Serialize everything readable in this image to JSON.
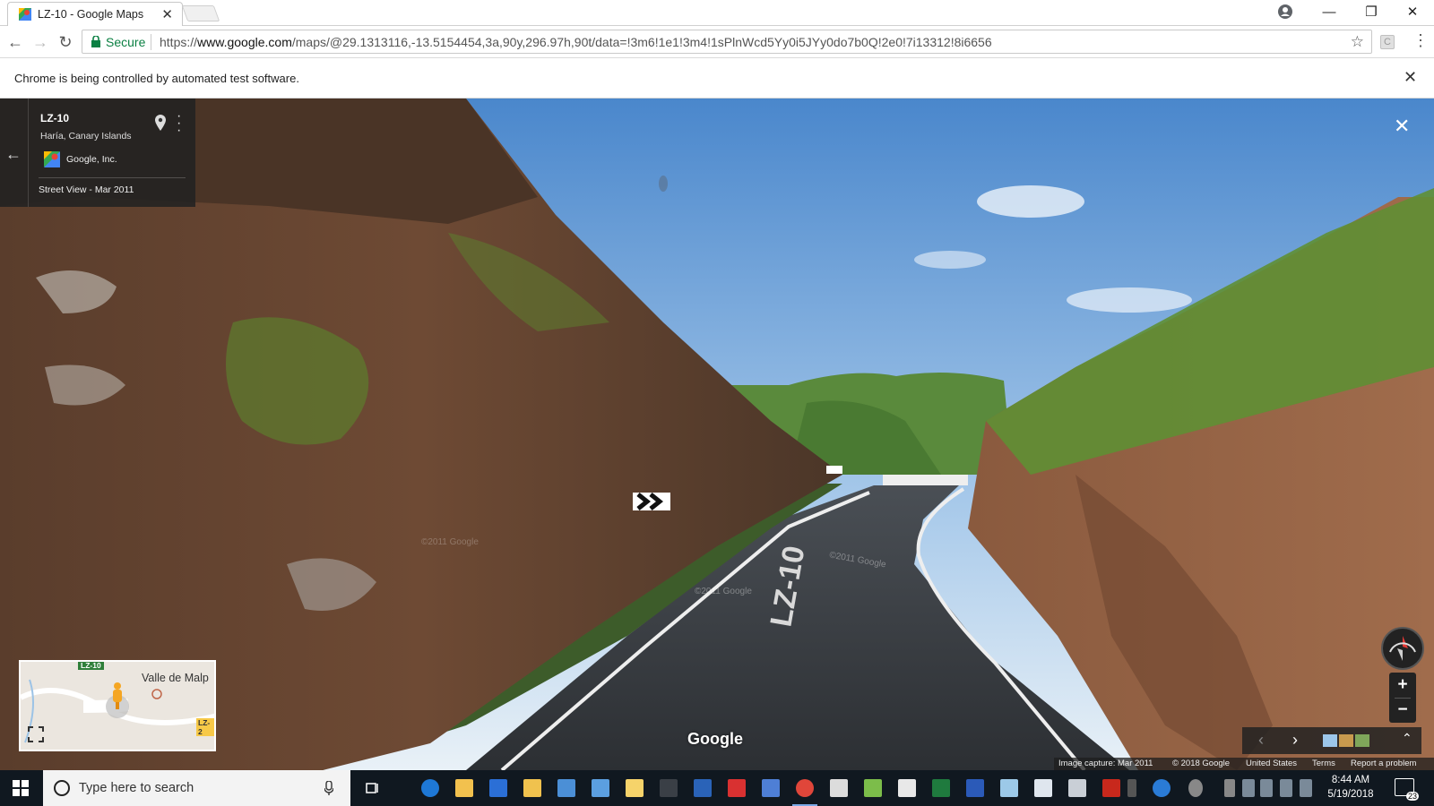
{
  "browser": {
    "tab_title": "LZ-10 - Google Maps",
    "tab_close": "✕",
    "secure_label": "Secure",
    "url_scheme": "https://",
    "url_host": "www.google.com",
    "url_path": "/maps/@29.1313116,-13.5154454,3a,90y,296.97h,90t/data=!3m6!1e1!3m4!1sPlnWcd5Yy0i5JYy0do7b0Q!2e0!7i13312!8i6656",
    "infobar_text": "Chrome is being controlled by automated test software.",
    "infobar_close": "✕",
    "minimize": "—",
    "restore": "❐",
    "close": "✕",
    "back": "←",
    "forward": "→",
    "reload": "↻",
    "star": "☆",
    "menu": "⋮"
  },
  "streetview": {
    "title": "LZ-10",
    "subtitle": "Haría, Canary Islands",
    "author": "Google, Inc.",
    "date": "Street View - Mar 2011",
    "back": "←",
    "close": "✕",
    "road_marking": "LZ-10",
    "watermark_1": "©2011 Google",
    "watermark_2": "©2011 Google",
    "watermark_3": "©2011 Google",
    "zoom_in": "+",
    "zoom_out": "−",
    "filmstrip_prev": "‹",
    "filmstrip_next": "›",
    "filmstrip_expand": "⌃",
    "google_logo": "Google",
    "footer": {
      "capture": "Image capture: Mar 2011",
      "copyright": "© 2018 Google",
      "country": "United States",
      "terms": "Terms",
      "report": "Report a problem"
    }
  },
  "minimap": {
    "road_label": "LZ-10",
    "place_label": "Valle de Malp",
    "road_label_2": "LZ-2"
  },
  "taskbar": {
    "search_placeholder": "Type here to search",
    "time": "8:44 AM",
    "date": "5/19/2018",
    "notifications": "23"
  },
  "colors": {
    "secure_green": "#0b8043",
    "taskbar_bg": "#101820",
    "infocard_bg": "#222222"
  }
}
